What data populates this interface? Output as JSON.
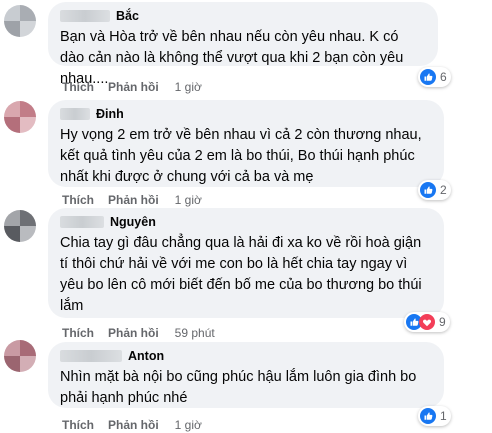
{
  "comments": [
    {
      "name": "Bắc",
      "text": "Bạn và Hòa trở về bên nhau nếu còn yêu nhau. K có dào cản nào là không thể vượt qua khi 2 bạn còn yêu nhau....",
      "like_label": "Thích",
      "reply_label": "Phản hồi",
      "time": "1 giờ",
      "reaction_count": "6",
      "reactions": [
        "like-icon"
      ],
      "avatar_color": "#b8bcc2"
    },
    {
      "name": "Đinh",
      "text": "Hy vọng 2 em trở về bên nhau vì cả 2 còn thương nhau, kết quả tình yêu của 2 em là bo thúi, Bo thúi hạnh phúc nhất khi được ở chung với cả ba và mẹ",
      "like_label": "Thích",
      "reply_label": "Phản hồi",
      "time": "1 giờ",
      "reaction_count": "2",
      "reactions": [
        "like-icon"
      ],
      "avatar_color": "#c98a94"
    },
    {
      "name": "Nguyên",
      "text": "Chia tay gì đâu chẳng qua là hải đi xa ko về rồi hoà giận tí thôi chứ hải về với me con bo là hết chia tay ngay vì yêu bo lên cô mới biết đến bố me của bo thương bo thúi lắm",
      "like_label": "Thích",
      "reply_label": "Phản hồi",
      "time": "59 phút",
      "reaction_count": "9",
      "reactions": [
        "like-icon",
        "love-icon"
      ],
      "avatar_color": "#7d7f84"
    },
    {
      "name": "Anton",
      "text": "Nhìn mặt bà nội bo cũng phúc hậu lắm luôn gia đình bo phải hạnh phúc nhé",
      "like_label": "Thích",
      "reply_label": "Phản hồi",
      "time": "1 giờ",
      "reaction_count": "1",
      "reactions": [
        "like-icon"
      ],
      "avatar_color": "#b07a86"
    }
  ],
  "colors": {
    "bubble_bg": "#f0f2f5",
    "action_text": "#65676b",
    "like_blue": "#1877f2",
    "love_red": "#f33e58"
  }
}
